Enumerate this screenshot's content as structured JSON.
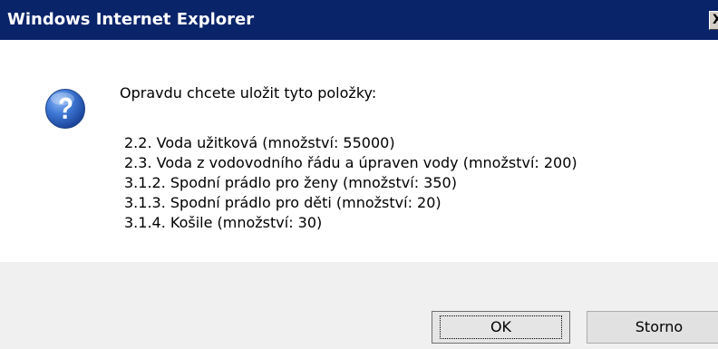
{
  "window": {
    "title": "Windows Internet Explorer",
    "close_label": "X"
  },
  "dialog": {
    "icon": "question-icon",
    "message": "Opravdu chcete uložit tyto položky:",
    "items": [
      "2.2.  Voda užitková  (množství: 55000)",
      "2.3.  Voda z vodovodního řádu a úpraven vody (množství: 200)",
      "3.1.2.  Spodní prádlo pro ženy  (množství: 350)",
      "3.1.3.  Spodní prádlo pro děti  (množství: 20)",
      "3.1.4.  Košile  (množství: 30)"
    ]
  },
  "buttons": {
    "ok_label": "OK",
    "cancel_label": "Storno"
  },
  "colors": {
    "titlebar": "#0a246a",
    "footer": "#f0f0f0",
    "icon_blue": "#2e64c0"
  }
}
